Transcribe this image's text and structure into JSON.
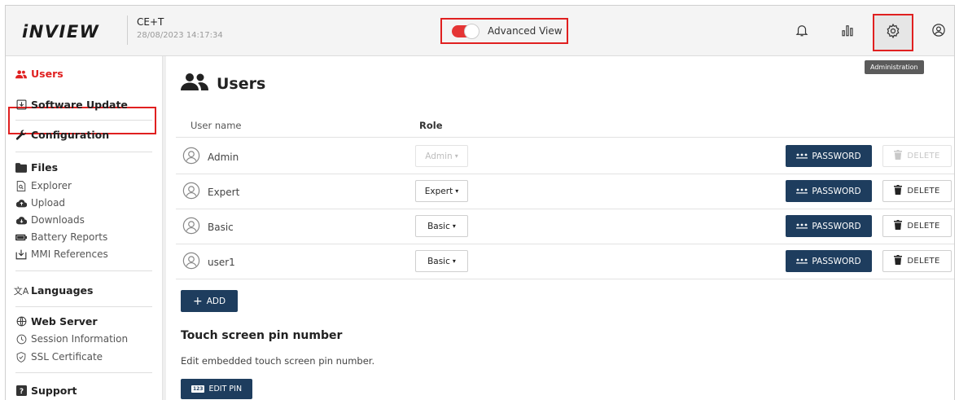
{
  "header": {
    "logo": "iNVIEW",
    "device_name": "CE+T",
    "datetime": "28/08/2023 14:17:34",
    "advanced_view_label": "Advanced View",
    "advanced_view_enabled": true,
    "icons": [
      "bell-icon",
      "chart-icon",
      "gear-icon",
      "user-circle-icon"
    ],
    "tooltip": "Administration"
  },
  "sidebar": {
    "users": "Users",
    "software_update": "Software Update",
    "configuration": "Configuration",
    "files": "Files",
    "explorer": "Explorer",
    "upload": "Upload",
    "downloads": "Downloads",
    "battery_reports": "Battery Reports",
    "mmi_references": "MMI References",
    "languages": "Languages",
    "web_server": "Web Server",
    "session_information": "Session Information",
    "ssl_certificate": "SSL Certificate",
    "support": "Support"
  },
  "main": {
    "title": "Users",
    "columns": {
      "user_name": "User name",
      "role": "Role"
    },
    "users": [
      {
        "name": "Admin",
        "role": "Admin",
        "role_enabled": false,
        "delete_enabled": false
      },
      {
        "name": "Expert",
        "role": "Expert",
        "role_enabled": true,
        "delete_enabled": true
      },
      {
        "name": "Basic",
        "role": "Basic",
        "role_enabled": true,
        "delete_enabled": true
      },
      {
        "name": "user1",
        "role": "Basic",
        "role_enabled": true,
        "delete_enabled": true
      }
    ],
    "password_label": "PASSWORD",
    "delete_label": "DELETE",
    "add_label": "ADD",
    "pin_title": "Touch screen pin number",
    "pin_description": "Edit embedded touch screen pin number.",
    "edit_pin_label": "EDIT PIN",
    "edit_pin_badge": "123"
  },
  "colors": {
    "accent_red": "#e02020",
    "button_navy": "#1e3d5e",
    "header_bg": "#f4f4f4"
  }
}
